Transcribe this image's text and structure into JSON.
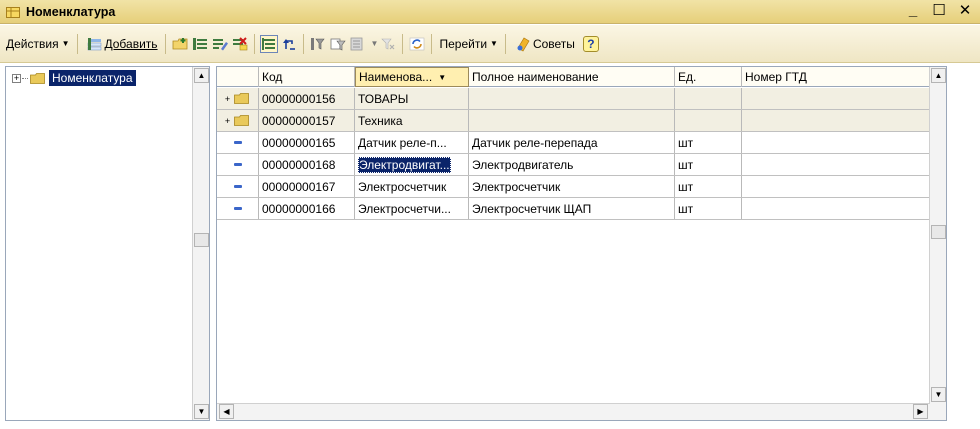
{
  "window": {
    "title": "Номенклатура",
    "minimize": "_",
    "maximize": "☐",
    "close": "✕"
  },
  "toolbar": {
    "actions_label": "Действия",
    "add_label": "Добавить",
    "goto_label": "Перейти",
    "tips_label": "Советы",
    "help_label": "?"
  },
  "tree": {
    "root_label": "Номенклатура",
    "expander": "+"
  },
  "table": {
    "columns": [
      "Код",
      "Наименова...",
      "Полное наименование",
      "Ед.",
      "Номер ГТД"
    ],
    "sort_indicator": "▼",
    "rows": [
      {
        "type": "group",
        "code": "00000000156",
        "name": "ТОВАРЫ",
        "full_name": "",
        "unit": "",
        "gtd": ""
      },
      {
        "type": "group",
        "code": "00000000157",
        "name": "Техника",
        "full_name": "",
        "unit": "",
        "gtd": ""
      },
      {
        "type": "item",
        "code": "00000000165",
        "name": "Датчик реле-п...",
        "full_name": "Датчик реле-перепада",
        "unit": "шт",
        "gtd": ""
      },
      {
        "type": "item",
        "code": "00000000168",
        "name": "Электродвигат...",
        "full_name": "Электродвигатель",
        "unit": "шт",
        "gtd": ""
      },
      {
        "type": "item",
        "code": "00000000167",
        "name": "Электросчетчик",
        "full_name": "Электросчетчик",
        "unit": "шт",
        "gtd": ""
      },
      {
        "type": "item",
        "code": "00000000166",
        "name": "Электросчетчи...",
        "full_name": "Электросчетчик ЩАП",
        "unit": "шт",
        "gtd": ""
      }
    ],
    "selected_row": 3
  },
  "colors": {
    "selection": "#0a246a",
    "titlebar": "#e6cf7a",
    "folder": "#e9c95a",
    "item_marker": "#3b66c9"
  }
}
